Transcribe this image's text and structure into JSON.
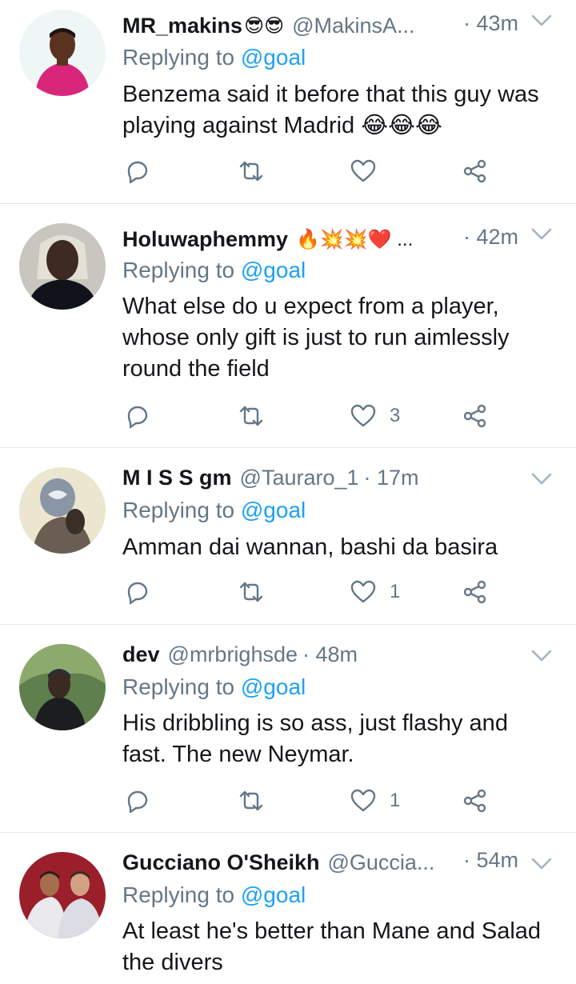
{
  "tweets": [
    {
      "name": "MR_makins",
      "name_emoji": "😎😎",
      "handle": "@MakinsA...",
      "time": "· 43m",
      "replying_prefix": "Replying to",
      "replying_to": "@goal",
      "text_lines": [
        "Benzema said it before that this guy was",
        "playing against Madrid 😂😂😂"
      ],
      "like_count": ""
    },
    {
      "name": "Holuwaphemmy",
      "name_emoji": "🔥💥💥❤️ ...",
      "handle": "",
      "time": "· 42m",
      "replying_prefix": "Replying to",
      "replying_to": "@goal",
      "text_lines": [
        "What else do u expect from a player,",
        "whose only gift is just to run aimlessly",
        "round the field"
      ],
      "like_count": "3"
    },
    {
      "name": "M I S S gm",
      "name_emoji": "",
      "handle": "@Tauraro_1",
      "time": "· 17m",
      "replying_prefix": "Replying to",
      "replying_to": "@goal",
      "text_lines": [
        "Amman dai wannan, bashi da basira"
      ],
      "like_count": "1"
    },
    {
      "name": "dev",
      "name_emoji": "",
      "handle": "@mrbrighsde",
      "time": "· 48m",
      "replying_prefix": "Replying to",
      "replying_to": "@goal",
      "text_lines": [
        "His dribbling is so ass, just flashy and",
        "fast. The new Neymar."
      ],
      "like_count": "1"
    },
    {
      "name": "Gucciano O'Sheikh",
      "name_emoji": "",
      "handle": "@Guccia...",
      "time": "· 54m",
      "replying_prefix": "Replying to",
      "replying_to": "@goal",
      "text_lines": [
        "At least he's better than Mane and Salad",
        "the divers"
      ],
      "like_count": ""
    }
  ],
  "icons": {
    "reply": "reply-icon",
    "retweet": "retweet-icon",
    "like": "heart-icon",
    "share": "share-icon",
    "more": "chevron-down-icon"
  },
  "colors": {
    "text_primary": "#14171a",
    "text_secondary": "#657786",
    "link": "#1da1f2",
    "divider": "#e1e8ed"
  }
}
